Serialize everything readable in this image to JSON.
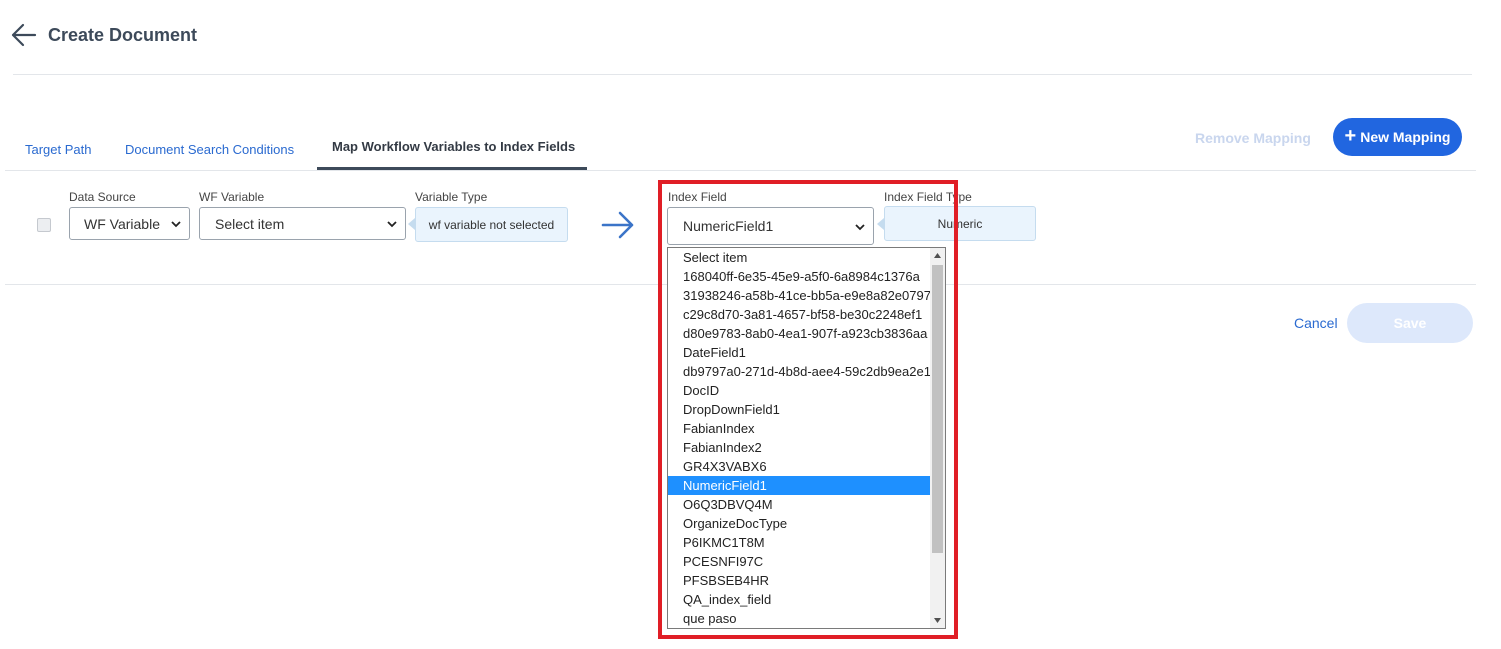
{
  "header": {
    "title": "Create Document"
  },
  "tabs": [
    {
      "label": "Target Path"
    },
    {
      "label": "Document Search Conditions"
    },
    {
      "label": "Map Workflow Variables to Index Fields"
    }
  ],
  "actions": {
    "remove_mapping": "Remove Mapping",
    "new_mapping": "New Mapping"
  },
  "mapping": {
    "data_source": {
      "label": "Data Source",
      "value": "WF Variable"
    },
    "wf_variable": {
      "label": "WF Variable",
      "value": "Select item"
    },
    "variable_type": {
      "label": "Variable Type",
      "value": "wf variable not selected"
    },
    "index_field": {
      "label": "Index Field",
      "value": "NumericField1"
    },
    "index_field_type": {
      "label": "Index Field Type",
      "value": "Numeric"
    }
  },
  "dropdown": {
    "options": [
      "Select item",
      "168040ff-6e35-45e9-a5f0-6a8984c1376a",
      "31938246-a58b-41ce-bb5a-e9e8a82e0797",
      "c29c8d70-3a81-4657-bf58-be30c2248ef1",
      "d80e9783-8ab0-4ea1-907f-a923cb3836aa",
      "DateField1",
      "db9797a0-271d-4b8d-aee4-59c2db9ea2e1",
      "DocID",
      "DropDownField1",
      "FabianIndex",
      "FabianIndex2",
      "GR4X3VABX6",
      "NumericField1",
      "O6Q3DBVQ4M",
      "OrganizeDocType",
      "P6IKMC1T8M",
      "PCESNFI97C",
      "PFSBSEB4HR",
      "QA_index_field",
      "que paso"
    ],
    "selected": "NumericField1"
  },
  "footer": {
    "cancel": "Cancel",
    "save": "Save"
  },
  "colors": {
    "primary": "#2166e0",
    "link": "#2a6ad0",
    "highlight": "#e01e26",
    "selected": "#1e90ff"
  }
}
